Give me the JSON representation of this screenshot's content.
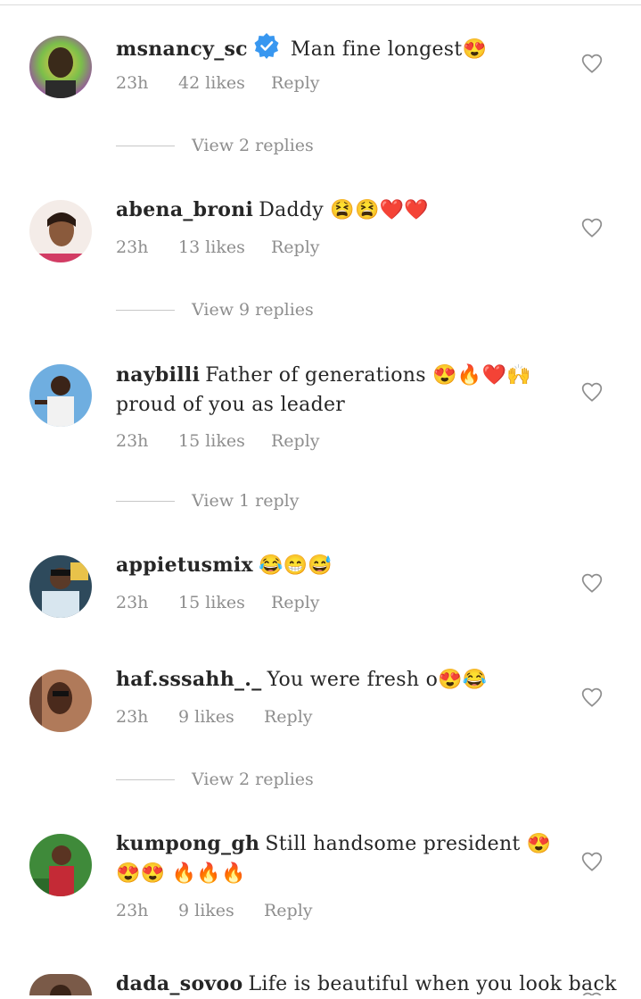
{
  "colors": {
    "text": "#262626",
    "secondary": "#8e8e8e",
    "verified": "#3897f0",
    "divider": "#dbdbdb"
  },
  "comments": [
    {
      "username": "msnancy_sc",
      "verified": true,
      "text": "Man fine longest😍",
      "time": "23h",
      "likes": "42 likes",
      "reply": "Reply",
      "view_replies": "View 2 replies"
    },
    {
      "username": "abena_broni",
      "verified": false,
      "text": "Daddy 😫😫❤️❤️",
      "time": "23h",
      "likes": "13 likes",
      "reply": "Reply",
      "view_replies": "View 9 replies"
    },
    {
      "username": "naybilli",
      "verified": false,
      "text": "Father of generations 😍🔥❤️🙌 proud of you as leader",
      "time": "23h",
      "likes": "15 likes",
      "reply": "Reply",
      "view_replies": "View 1 reply"
    },
    {
      "username": "appietusmix",
      "verified": false,
      "text": "😂😁😅",
      "time": "23h",
      "likes": "15 likes",
      "reply": "Reply"
    },
    {
      "username": "haf.sssahh_._",
      "verified": false,
      "text": "You were fresh o😍😂",
      "time": "23h",
      "likes": "9 likes",
      "reply": "Reply",
      "view_replies": "View 2 replies"
    },
    {
      "username": "kumpong_gh",
      "verified": false,
      "text": "Still handsome president 😍😍😍 🔥🔥🔥",
      "time": "23h",
      "likes": "9 likes",
      "reply": "Reply"
    },
    {
      "username": "dada_sovoo",
      "verified": false,
      "text": "Life is beautiful when you look back"
    }
  ]
}
